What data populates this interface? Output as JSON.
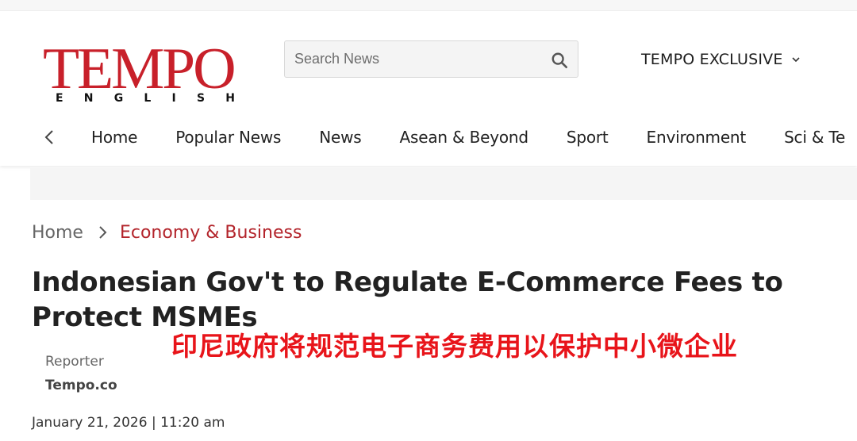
{
  "brand": {
    "logo_main": "TEMPO",
    "logo_sub": [
      "E",
      "N",
      "G",
      "L",
      "I",
      "S",
      "H"
    ],
    "color": "#c8202a"
  },
  "search": {
    "placeholder": "Search News",
    "icon": "search-icon"
  },
  "header_menu": {
    "label": "TEMPO EXCLUSIVE",
    "icon": "chevron-down-icon"
  },
  "nav": {
    "prev_icon": "chevron-left-icon",
    "items": [
      "Home",
      "Popular News",
      "News",
      "Asean & Beyond",
      "Sport",
      "Environment",
      "Sci & Te"
    ]
  },
  "breadcrumb": {
    "home": "Home",
    "separator_icon": "chevron-right-icon",
    "category": "Economy & Business",
    "category_color": "#b3242b"
  },
  "article": {
    "title": "Indonesian Gov't to Regulate E-Commerce Fees to Protect MSMEs",
    "overlay_text": "印尼政府将规范电子商务费用以保护中小微企业",
    "overlay_color": "#e8141a",
    "reporter_label": "Reporter",
    "reporter_name": "Tempo.co",
    "dateline": "January 21, 2026 | 11:20 am"
  }
}
